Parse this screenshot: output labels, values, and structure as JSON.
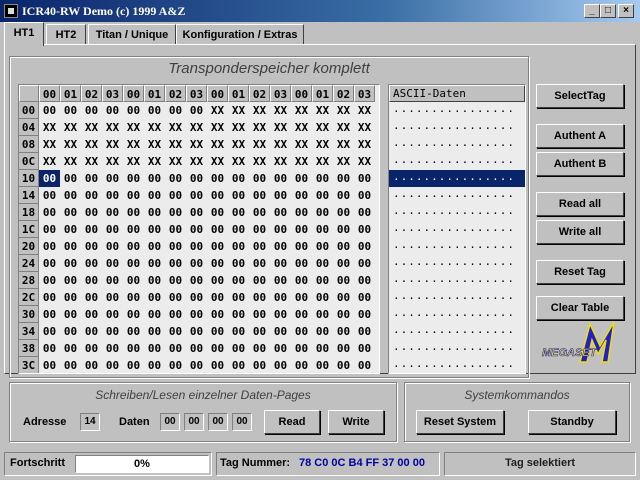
{
  "window": {
    "title": "ICR40-RW Demo (c) 1999 A&Z",
    "icon": "app-icon",
    "controls": {
      "minimize": "_",
      "maximize": "□",
      "close": "×"
    }
  },
  "tabs": [
    {
      "label": "HT1",
      "active": true
    },
    {
      "label": "HT2",
      "active": false
    },
    {
      "label": "Titan / Unique",
      "active": false
    },
    {
      "label": "Konfiguration / Extras",
      "active": false
    }
  ],
  "memory": {
    "title": "Transponderspeicher komplett",
    "column_headers": [
      "00",
      "01",
      "02",
      "03",
      "00",
      "01",
      "02",
      "03",
      "00",
      "01",
      "02",
      "03",
      "00",
      "01",
      "02",
      "03"
    ],
    "row_headers": [
      "00",
      "04",
      "08",
      "0C",
      "10",
      "14",
      "18",
      "1C",
      "20",
      "24",
      "28",
      "2C",
      "30",
      "34",
      "38",
      "3C"
    ],
    "rows": [
      [
        "00",
        "00",
        "00",
        "00",
        "00",
        "00",
        "00",
        "00",
        "XX",
        "XX",
        "XX",
        "XX",
        "XX",
        "XX",
        "XX",
        "XX"
      ],
      [
        "XX",
        "XX",
        "XX",
        "XX",
        "XX",
        "XX",
        "XX",
        "XX",
        "XX",
        "XX",
        "XX",
        "XX",
        "XX",
        "XX",
        "XX",
        "XX"
      ],
      [
        "XX",
        "XX",
        "XX",
        "XX",
        "XX",
        "XX",
        "XX",
        "XX",
        "XX",
        "XX",
        "XX",
        "XX",
        "XX",
        "XX",
        "XX",
        "XX"
      ],
      [
        "XX",
        "XX",
        "XX",
        "XX",
        "XX",
        "XX",
        "XX",
        "XX",
        "XX",
        "XX",
        "XX",
        "XX",
        "XX",
        "XX",
        "XX",
        "XX"
      ],
      [
        "00",
        "00",
        "00",
        "00",
        "00",
        "00",
        "00",
        "00",
        "00",
        "00",
        "00",
        "00",
        "00",
        "00",
        "00",
        "00"
      ],
      [
        "00",
        "00",
        "00",
        "00",
        "00",
        "00",
        "00",
        "00",
        "00",
        "00",
        "00",
        "00",
        "00",
        "00",
        "00",
        "00"
      ],
      [
        "00",
        "00",
        "00",
        "00",
        "00",
        "00",
        "00",
        "00",
        "00",
        "00",
        "00",
        "00",
        "00",
        "00",
        "00",
        "00"
      ],
      [
        "00",
        "00",
        "00",
        "00",
        "00",
        "00",
        "00",
        "00",
        "00",
        "00",
        "00",
        "00",
        "00",
        "00",
        "00",
        "00"
      ],
      [
        "00",
        "00",
        "00",
        "00",
        "00",
        "00",
        "00",
        "00",
        "00",
        "00",
        "00",
        "00",
        "00",
        "00",
        "00",
        "00"
      ],
      [
        "00",
        "00",
        "00",
        "00",
        "00",
        "00",
        "00",
        "00",
        "00",
        "00",
        "00",
        "00",
        "00",
        "00",
        "00",
        "00"
      ],
      [
        "00",
        "00",
        "00",
        "00",
        "00",
        "00",
        "00",
        "00",
        "00",
        "00",
        "00",
        "00",
        "00",
        "00",
        "00",
        "00"
      ],
      [
        "00",
        "00",
        "00",
        "00",
        "00",
        "00",
        "00",
        "00",
        "00",
        "00",
        "00",
        "00",
        "00",
        "00",
        "00",
        "00"
      ],
      [
        "00",
        "00",
        "00",
        "00",
        "00",
        "00",
        "00",
        "00",
        "00",
        "00",
        "00",
        "00",
        "00",
        "00",
        "00",
        "00"
      ],
      [
        "00",
        "00",
        "00",
        "00",
        "00",
        "00",
        "00",
        "00",
        "00",
        "00",
        "00",
        "00",
        "00",
        "00",
        "00",
        "00"
      ],
      [
        "00",
        "00",
        "00",
        "00",
        "00",
        "00",
        "00",
        "00",
        "00",
        "00",
        "00",
        "00",
        "00",
        "00",
        "00",
        "00"
      ],
      [
        "00",
        "00",
        "00",
        "00",
        "00",
        "00",
        "00",
        "00",
        "00",
        "00",
        "00",
        "00",
        "00",
        "00",
        "00",
        "00"
      ]
    ],
    "selected_cell": {
      "row": 4,
      "col": 0
    },
    "ascii_header": "ASCII-Daten",
    "ascii_rows": [
      "................",
      "................",
      "................",
      "................",
      "................",
      "................",
      "................",
      "................",
      "................",
      "................",
      "................",
      "................",
      "................",
      "................",
      "................",
      "................"
    ],
    "selected_ascii_row": 4
  },
  "buttons": {
    "select_tag": "SelectTag",
    "authent_a": "Authent A",
    "authent_b": "Authent B",
    "read_all": "Read all",
    "write_all": "Write all",
    "reset_tag": "Reset Tag",
    "clear_table": "Clear Table"
  },
  "logo": {
    "text": "MEGASET",
    "mark": "M"
  },
  "rw_group": {
    "title": "Schreiben/Lesen einzelner Daten-Pages",
    "address_label": "Adresse",
    "address_value": "14",
    "data_label": "Daten",
    "data_values": [
      "00",
      "00",
      "00",
      "00"
    ],
    "read": "Read",
    "write": "Write"
  },
  "sys_group": {
    "title": "Systemkommandos",
    "reset_system": "Reset System",
    "standby": "Standby"
  },
  "status": {
    "progress_label": "Fortschritt",
    "progress_text": "0%",
    "progress_fraction": 0,
    "tag_label": "Tag Nummer:",
    "tag_value": "78 C0 0C B4 FF 37 00 00",
    "tag_value_color": "#0000a0",
    "state": "Tag selektiert"
  },
  "colors": {
    "selection": "#0a246a",
    "logo_blue": "#1f1fd0",
    "logo_yellow": "#f0e000"
  }
}
